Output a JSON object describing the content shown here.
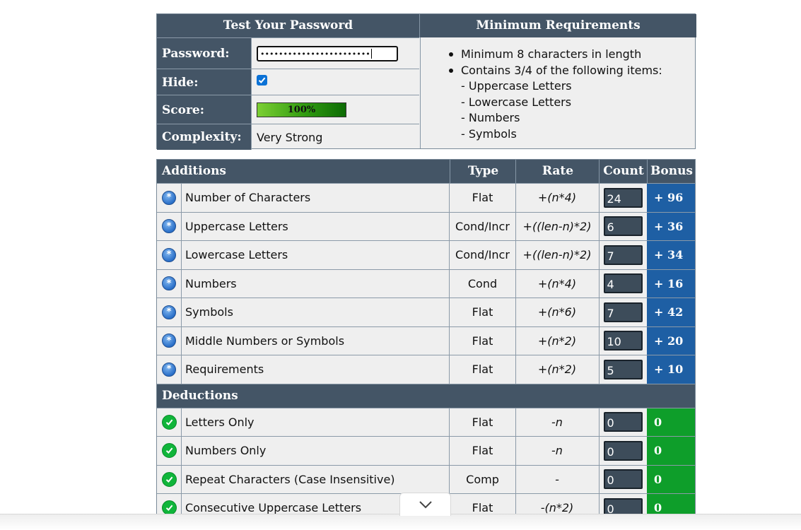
{
  "top": {
    "test_title": "Test Your Password",
    "req_title": "Minimum Requirements",
    "password_label": "Password:",
    "password_value": "••••••••••••••••••••••••",
    "hide_label": "Hide:",
    "hide_checked": true,
    "score_label": "Score:",
    "score_value": "100%",
    "score_fraction": 1.0,
    "complexity_label": "Complexity:",
    "complexity_value": "Very Strong",
    "requirements": [
      {
        "bullet": true,
        "text": "Minimum 8 characters in length"
      },
      {
        "bullet": true,
        "text": "Contains 3/4 of the following items:"
      },
      {
        "bullet": false,
        "text": "- Uppercase Letters"
      },
      {
        "bullet": false,
        "text": "- Lowercase Letters"
      },
      {
        "bullet": false,
        "text": "- Numbers"
      },
      {
        "bullet": false,
        "text": "- Symbols"
      }
    ]
  },
  "table": {
    "headers": {
      "additions": "Additions",
      "type": "Type",
      "rate": "Rate",
      "count": "Count",
      "bonus": "Bonus"
    },
    "deductions_title": "Deductions",
    "additions": [
      {
        "name": "Number of Characters",
        "type": "Flat",
        "rate": "+(n*4)",
        "count": "24",
        "bonus": "+ 96"
      },
      {
        "name": "Uppercase Letters",
        "type": "Cond/Incr",
        "rate": "+((len-n)*2)",
        "count": "6",
        "bonus": "+ 36"
      },
      {
        "name": "Lowercase Letters",
        "type": "Cond/Incr",
        "rate": "+((len-n)*2)",
        "count": "7",
        "bonus": "+ 34"
      },
      {
        "name": "Numbers",
        "type": "Cond",
        "rate": "+(n*4)",
        "count": "4",
        "bonus": "+ 16"
      },
      {
        "name": "Symbols",
        "type": "Flat",
        "rate": "+(n*6)",
        "count": "7",
        "bonus": "+ 42"
      },
      {
        "name": "Middle Numbers or Symbols",
        "type": "Flat",
        "rate": "+(n*2)",
        "count": "10",
        "bonus": "+ 20"
      },
      {
        "name": "Requirements",
        "type": "Flat",
        "rate": "+(n*2)",
        "count": "5",
        "bonus": "+ 10"
      }
    ],
    "deductions": [
      {
        "name": "Letters Only",
        "type": "Flat",
        "rate": "-n",
        "count": "0",
        "bonus": "0"
      },
      {
        "name": "Numbers Only",
        "type": "Flat",
        "rate": "-n",
        "count": "0",
        "bonus": "0"
      },
      {
        "name": "Repeat Characters (Case Insensitive)",
        "type": "Comp",
        "rate": "-",
        "count": "0",
        "bonus": "0"
      },
      {
        "name": "Consecutive Uppercase Letters",
        "type": "Flat",
        "rate": "-(n*2)",
        "count": "0",
        "bonus": "0"
      }
    ]
  },
  "colors": {
    "header_bg": "#445566",
    "bonus_blue": "#1e5fa4",
    "bonus_green": "#0e9e2a"
  },
  "icons": {
    "addition": "plus-circle-icon",
    "deduction": "check-circle-icon",
    "scroll": "chevron-down-icon"
  }
}
